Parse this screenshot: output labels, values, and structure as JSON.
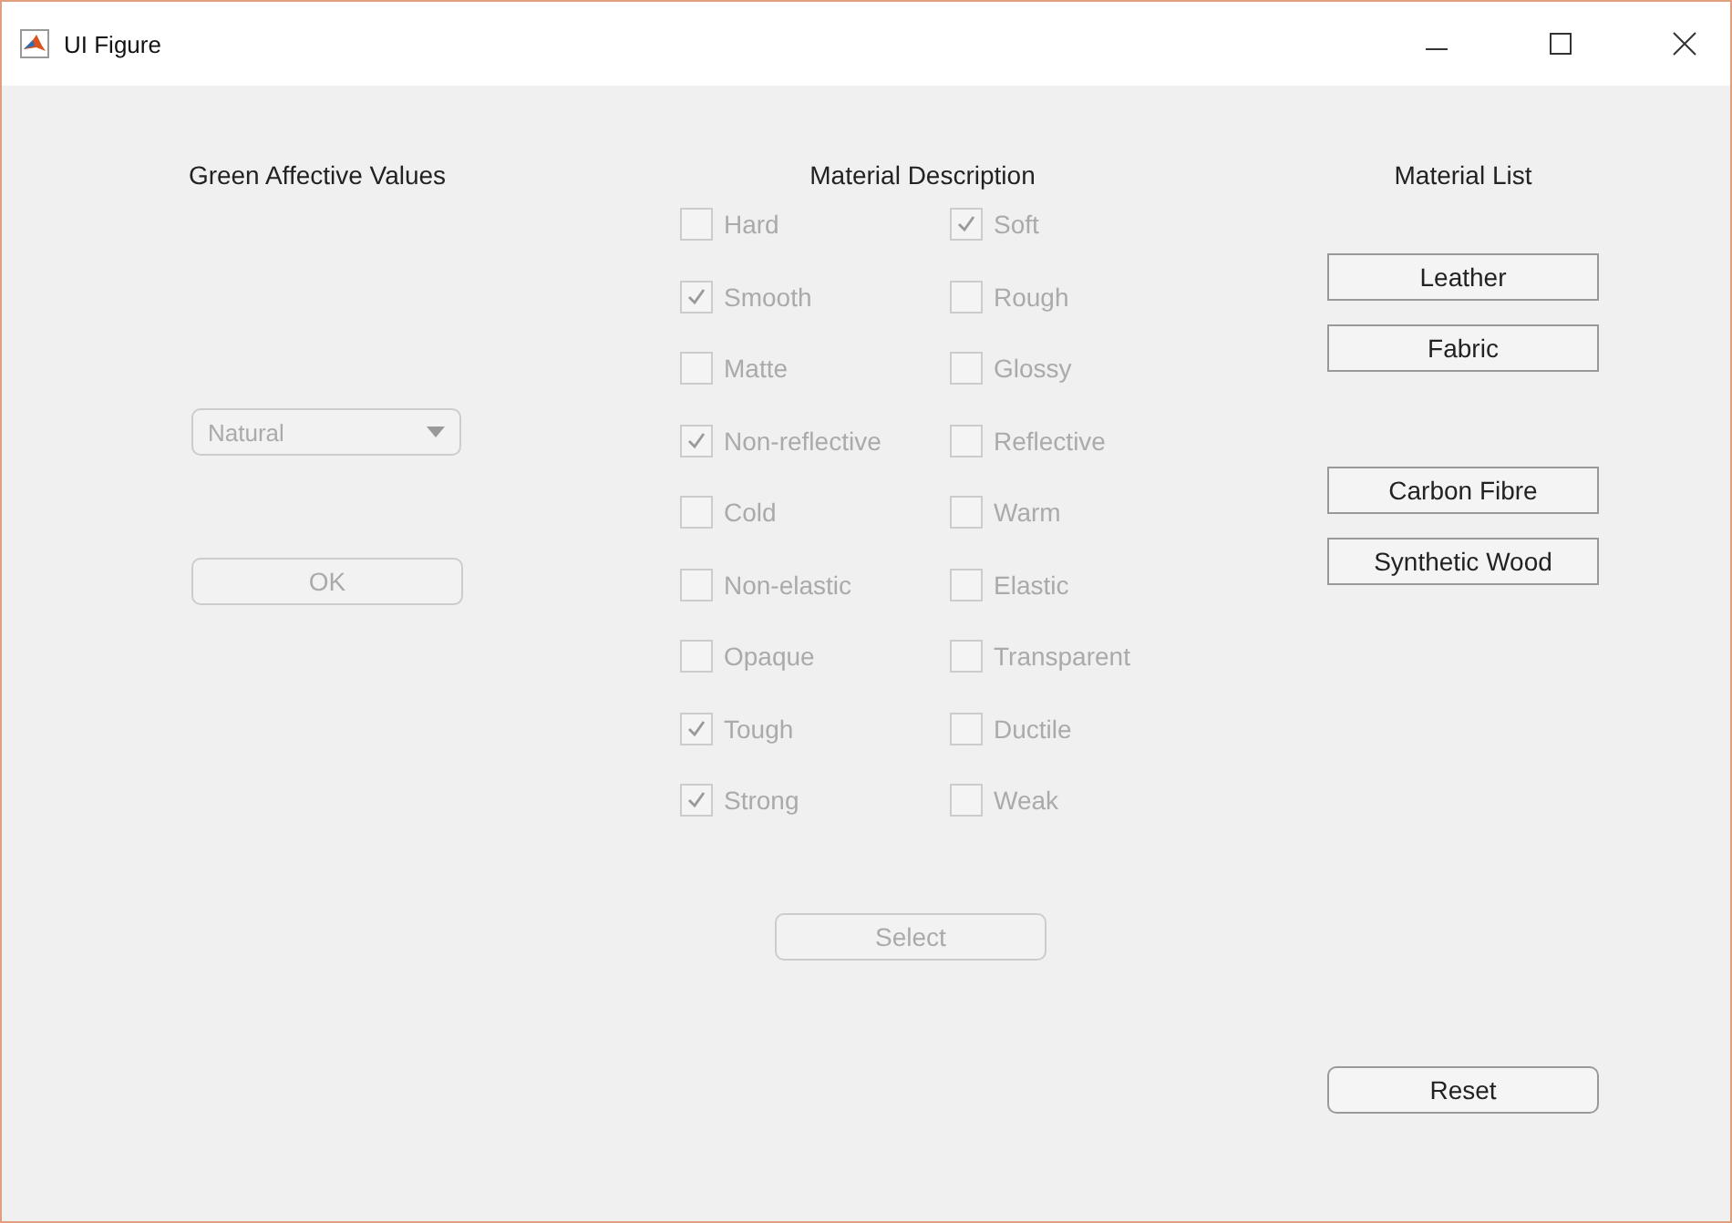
{
  "window": {
    "title": "UI Figure"
  },
  "affective": {
    "title": "Green Affective Values",
    "dropdown": {
      "value": "Natural",
      "disabled": true
    },
    "ok_button": {
      "label": "OK",
      "disabled": true
    }
  },
  "description": {
    "title": "Material Description",
    "rows": [
      [
        {
          "label": "Hard",
          "checked": false,
          "disabled": true
        },
        {
          "label": "Soft",
          "checked": true,
          "disabled": true
        }
      ],
      [
        {
          "label": "Smooth",
          "checked": true,
          "disabled": true
        },
        {
          "label": "Rough",
          "checked": false,
          "disabled": true
        }
      ],
      [
        {
          "label": "Matte",
          "checked": false,
          "disabled": true
        },
        {
          "label": "Glossy",
          "checked": false,
          "disabled": true
        }
      ],
      [
        {
          "label": "Non-reflective",
          "checked": true,
          "disabled": true
        },
        {
          "label": "Reflective",
          "checked": false,
          "disabled": true
        }
      ],
      [
        {
          "label": "Cold",
          "checked": false,
          "disabled": true
        },
        {
          "label": "Warm",
          "checked": false,
          "disabled": true
        }
      ],
      [
        {
          "label": "Non-elastic",
          "checked": false,
          "disabled": true
        },
        {
          "label": "Elastic",
          "checked": false,
          "disabled": true
        }
      ],
      [
        {
          "label": "Opaque",
          "checked": false,
          "disabled": true
        },
        {
          "label": "Transparent",
          "checked": false,
          "disabled": true
        }
      ],
      [
        {
          "label": "Tough",
          "checked": true,
          "disabled": true
        },
        {
          "label": "Ductile",
          "checked": false,
          "disabled": true
        }
      ],
      [
        {
          "label": "Strong",
          "checked": true,
          "disabled": true
        },
        {
          "label": "Weak",
          "checked": false,
          "disabled": true
        }
      ]
    ],
    "select_button": {
      "label": "Select",
      "disabled": true
    }
  },
  "material_list": {
    "title": "Material List",
    "groups": [
      [
        "Leather",
        "Fabric"
      ],
      [
        "Carbon Fibre",
        "Synthetic Wood"
      ]
    ]
  },
  "reset_button": {
    "label": "Reset",
    "disabled": false
  }
}
